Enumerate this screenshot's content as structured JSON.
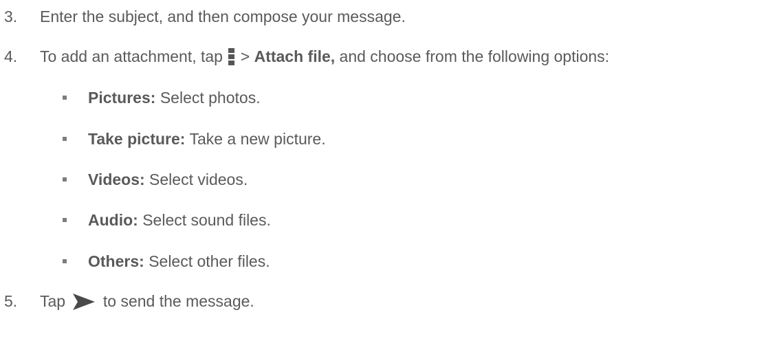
{
  "steps": [
    {
      "number": "3.",
      "text": "Enter the subject, and then compose your message."
    },
    {
      "number": "4.",
      "before": "To add an attachment, tap",
      "sep": ">",
      "bold": "Attach file,",
      "after": "and choose from the following options:",
      "options": [
        {
          "label": "Pictures:",
          "desc": "Select photos."
        },
        {
          "label": "Take picture:",
          "desc": "Take a new picture."
        },
        {
          "label": "Videos:",
          "desc": "Select videos."
        },
        {
          "label": "Audio:",
          "desc": "Select sound files."
        },
        {
          "label": "Others:",
          "desc": "Select other files."
        }
      ]
    },
    {
      "number": "5.",
      "before": "Tap",
      "after": "to send the message."
    }
  ],
  "icons": {
    "menu": "menu-icon",
    "send": "send-icon"
  }
}
